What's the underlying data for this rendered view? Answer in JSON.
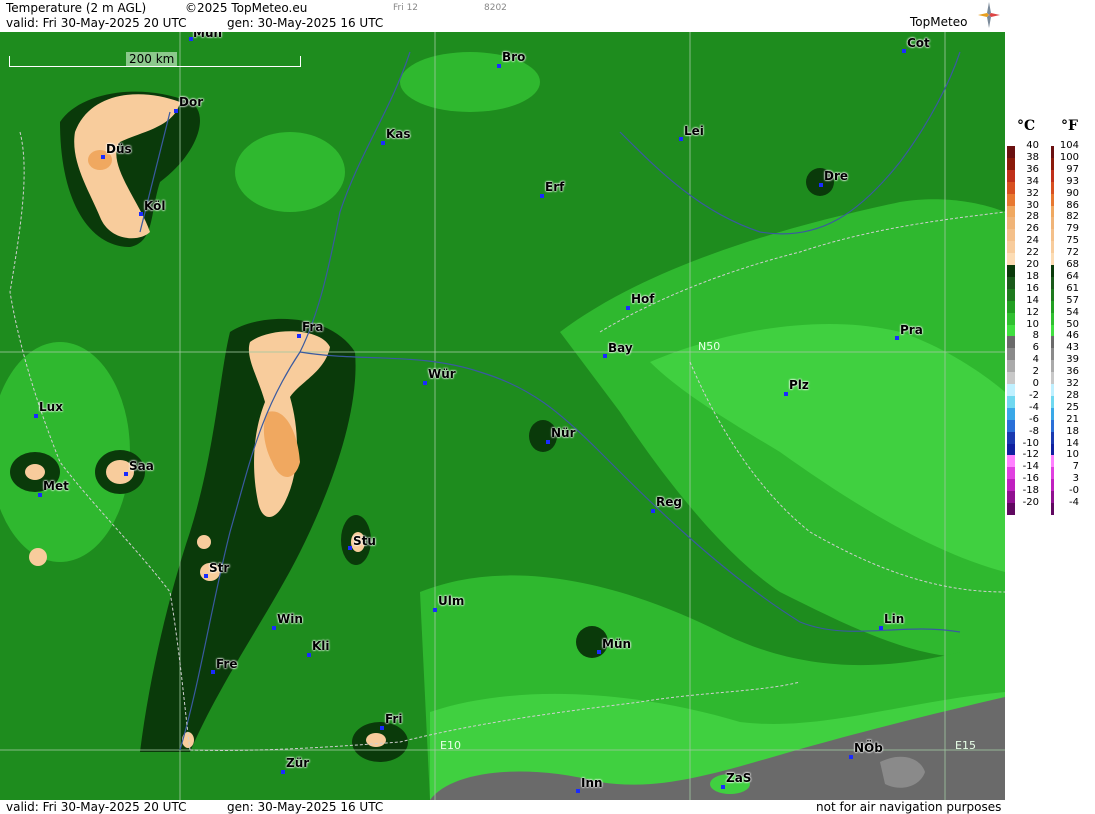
{
  "header": {
    "title": "Temperature (2 m AGL)",
    "copyright": "©2025 TopMeteo.eu",
    "run_short": "Fri 12",
    "code": "8202",
    "valid": "valid:  Fri  30-May-2025  20 UTC",
    "generated": "gen:  30-May-2025 16 UTC",
    "logo": "TopMeteo"
  },
  "footer": {
    "valid": "valid:  Fri  30-May-2025  20 UTC",
    "generated": "gen:  30-May-2025 16 UTC",
    "notice": "not for air navigation purposes"
  },
  "scale_bar": "200 km",
  "grid_labels": [
    "N50",
    "E10",
    "E15"
  ],
  "cities": [
    {
      "name": "Mün",
      "id": "muenster"
    },
    {
      "name": "Bro"
    },
    {
      "name": "Cot"
    },
    {
      "name": "Dor"
    },
    {
      "name": "Kas"
    },
    {
      "name": "Lei"
    },
    {
      "name": "Düs"
    },
    {
      "name": "Erf"
    },
    {
      "name": "Dre"
    },
    {
      "name": "Köl"
    },
    {
      "name": "Hof"
    },
    {
      "name": "Fra"
    },
    {
      "name": "Bay"
    },
    {
      "name": "Pra"
    },
    {
      "name": "Wür"
    },
    {
      "name": "Plz"
    },
    {
      "name": "Lux"
    },
    {
      "name": "Nür"
    },
    {
      "name": "Saa"
    },
    {
      "name": "Met"
    },
    {
      "name": "Reg"
    },
    {
      "name": "Stu"
    },
    {
      "name": "Str"
    },
    {
      "name": "Ulm"
    },
    {
      "name": "Win"
    },
    {
      "name": "Kli"
    },
    {
      "name": "Mün"
    },
    {
      "name": "Lin"
    },
    {
      "name": "Fre"
    },
    {
      "name": "Fri"
    },
    {
      "name": "NÖb"
    },
    {
      "name": "Zür"
    },
    {
      "name": "Inn"
    },
    {
      "name": "ZaS"
    }
  ],
  "legend": {
    "celsius_unit": "°C",
    "fahrenheit_unit": "°F",
    "celsius": [
      "40",
      "38",
      "36",
      "34",
      "32",
      "30",
      "28",
      "26",
      "24",
      "22",
      "20",
      "18",
      "16",
      "14",
      "12",
      "10",
      "8",
      "6",
      "4",
      "2",
      "0",
      "-2",
      "-4",
      "-6",
      "-8",
      "-10",
      "-12",
      "-14",
      "-16",
      "-18",
      "-20"
    ],
    "fahrenheit": [
      "104",
      "100",
      "97",
      "93",
      "90",
      "86",
      "82",
      "79",
      "75",
      "72",
      "68",
      "64",
      "61",
      "57",
      "54",
      "50",
      "46",
      "43",
      "39",
      "36",
      "32",
      "28",
      "25",
      "21",
      "18",
      "14",
      "10",
      "7",
      "3",
      "-0",
      "-4"
    ],
    "colors": [
      "#6a1010",
      "#8a1a0a",
      "#c0301a",
      "#d85020",
      "#e87830",
      "#f0a860",
      "#f0b478",
      "#f4c08a",
      "#f8cc9c",
      "#fcdcb4",
      "#0a3a0a",
      "#1a5a1a",
      "#1e7a1e",
      "#22a022",
      "#30c030",
      "#40e040",
      "#6a6a6a",
      "#8a8a8a",
      "#aaaaaa",
      "#c8c8c8",
      "#c0f0ff",
      "#70d8f0",
      "#3aa8e8",
      "#2a70d8",
      "#1a3ab0",
      "#1020a0",
      "#ff80ff",
      "#e040e0",
      "#c020c0",
      "#901090",
      "#600860"
    ]
  }
}
